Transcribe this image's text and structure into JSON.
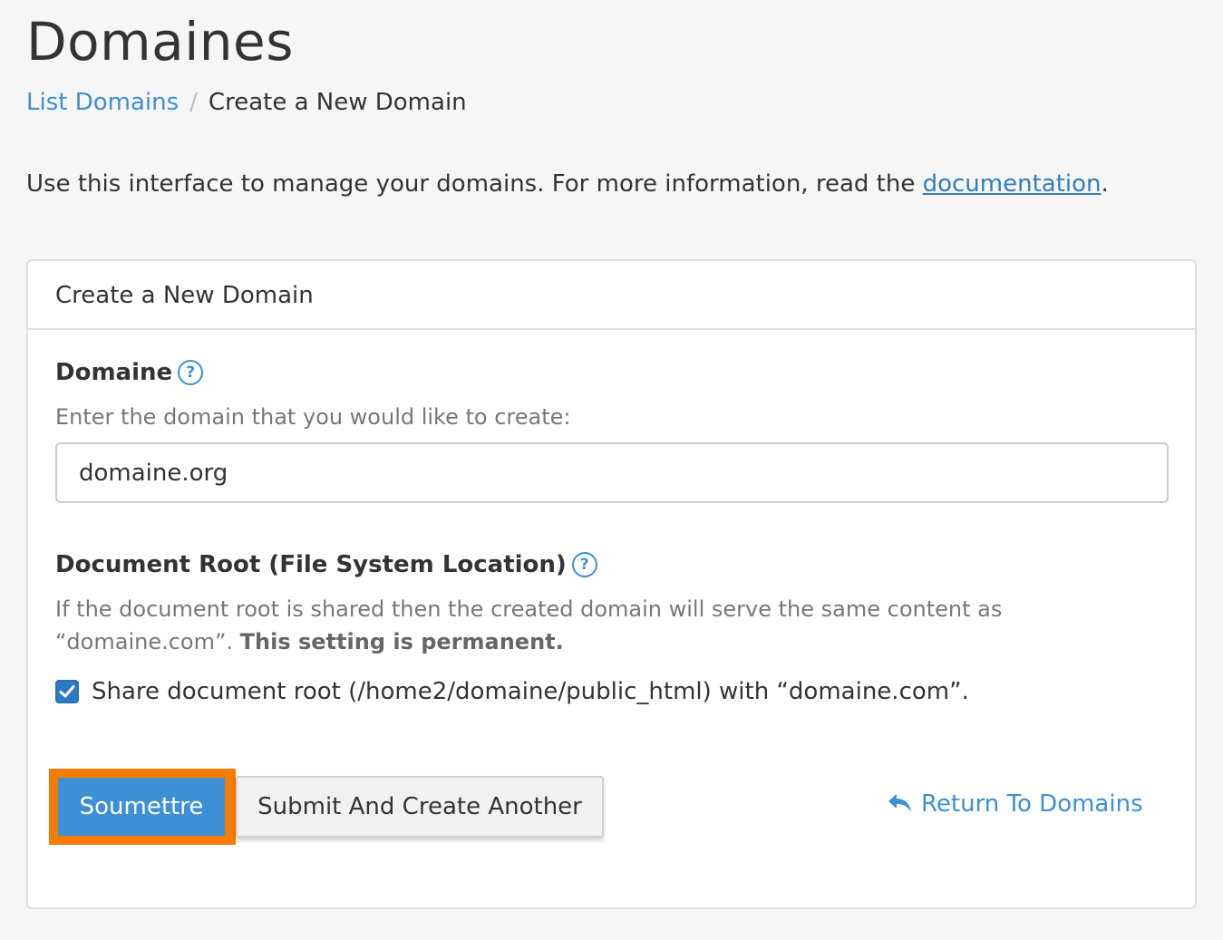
{
  "page": {
    "title": "Domaines"
  },
  "breadcrumb": {
    "link": "List Domains",
    "separator": "/",
    "current": "Create a New Domain"
  },
  "intro": {
    "text": "Use this interface to manage your domains. For more information, read the ",
    "link": "documentation",
    "suffix": "."
  },
  "panel": {
    "heading": "Create a New Domain",
    "domain": {
      "label": "Domaine",
      "help_icon": "question-circle-icon",
      "help_text": "Enter the domain that you would like to create:",
      "value": "domaine.org"
    },
    "docroot": {
      "label": "Document Root (File System Location)",
      "help_icon": "question-circle-icon",
      "help_text_1": "If the document root is shared then the created domain will serve the same content as",
      "help_text_2": "“domaine.com”. ",
      "help_text_bold": "This setting is permanent.",
      "checkbox_label": "Share document root (/home2/domaine/public_html) with “domaine.com”.",
      "checkbox_checked": true
    },
    "actions": {
      "submit": "Soumettre",
      "submit_another": "Submit And Create Another",
      "return_icon": "reply-arrow-icon",
      "return": "Return To Domains"
    }
  },
  "colors": {
    "accent": "#3d8fd6",
    "highlight": "#f57c00",
    "background": "#f6f6f6"
  }
}
